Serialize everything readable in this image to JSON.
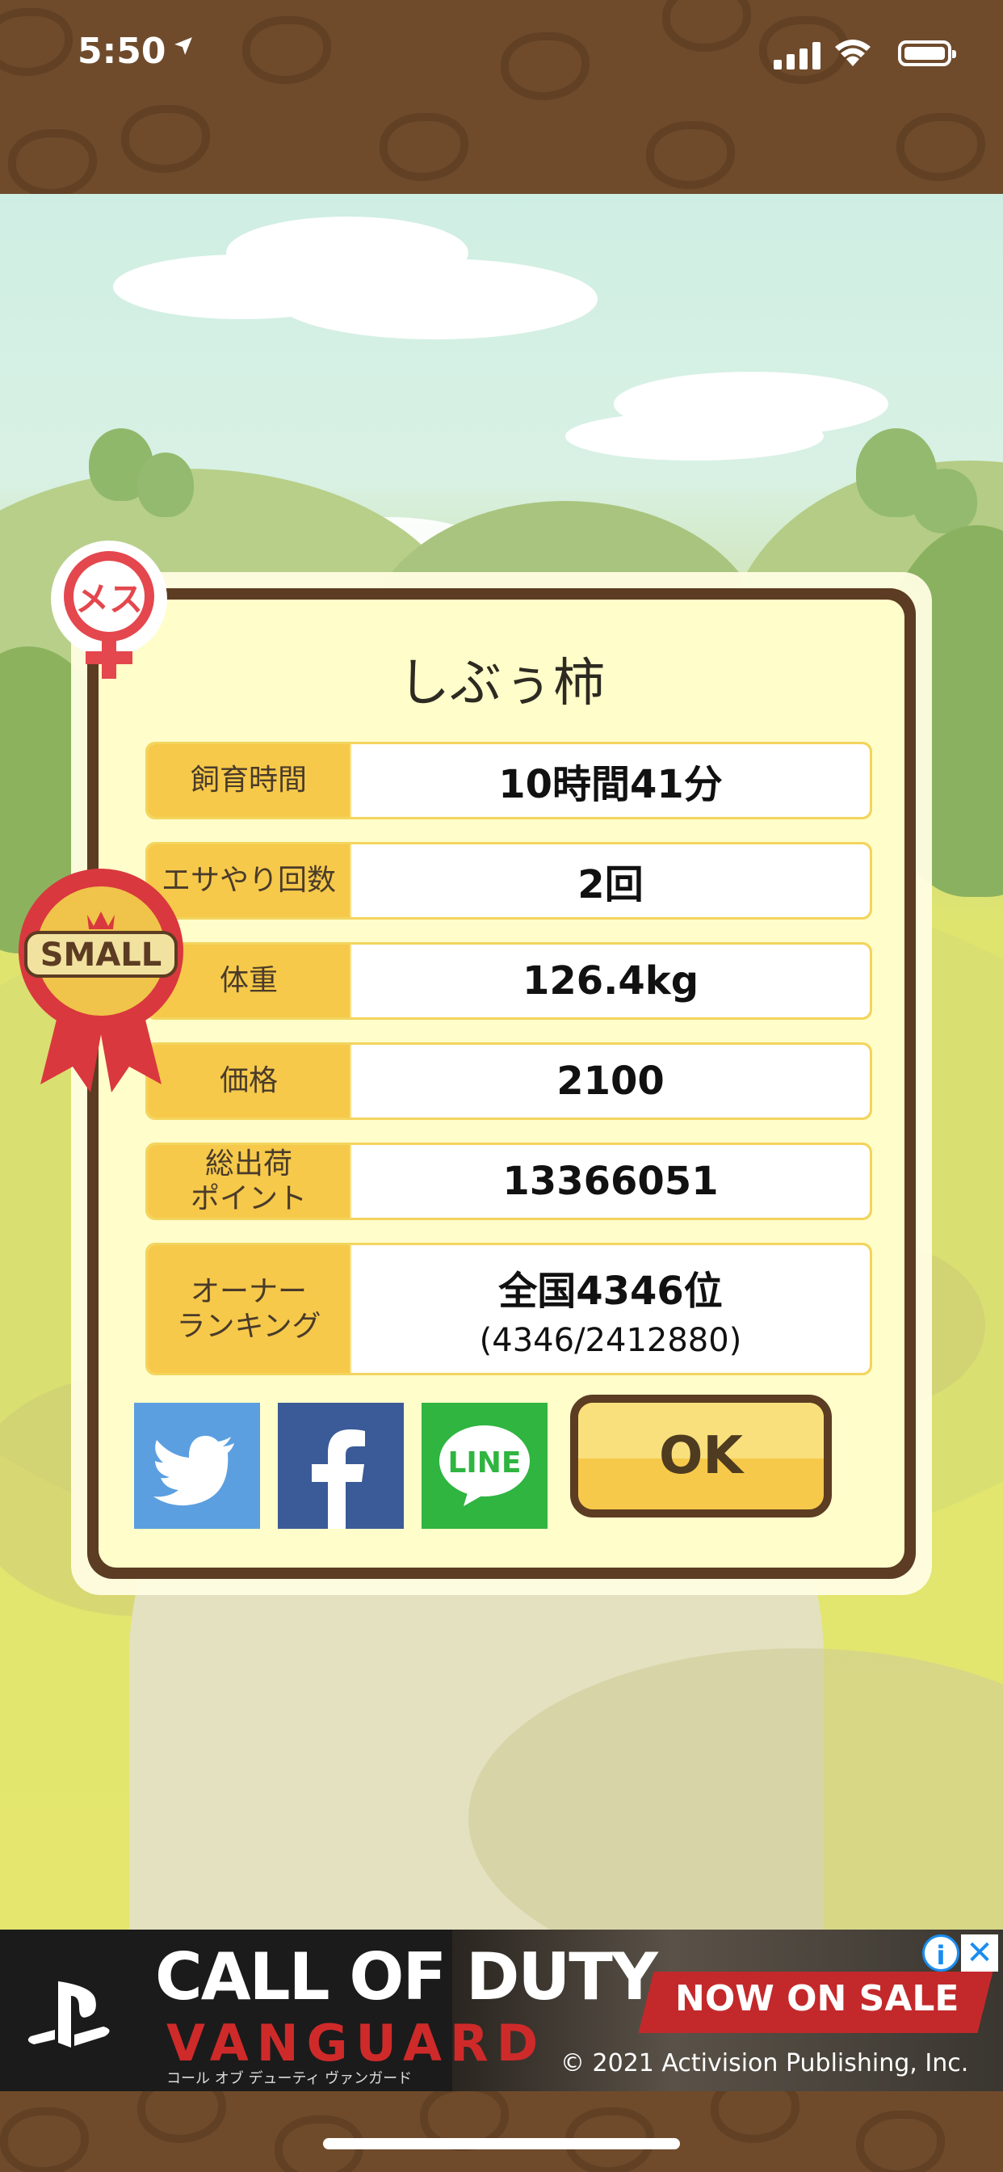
{
  "status_bar": {
    "time": "5:50"
  },
  "dialog": {
    "title": "しぶぅ柿",
    "rows": [
      {
        "label": "飼育時間",
        "value": "10時間41分"
      },
      {
        "label": "エサやり回数",
        "value": "2回"
      },
      {
        "label": "体重",
        "value": "126.4kg"
      },
      {
        "label": "価格",
        "value": "2100"
      },
      {
        "label": "総出荷\nポイント",
        "value": "13366051"
      },
      {
        "label": "オーナー\nランキング",
        "value": "全国4346位",
        "sub": "(4346/2412880)"
      }
    ],
    "share": {
      "twitter_icon": "twitter-icon",
      "facebook_label": "f",
      "line_label": "LINE"
    },
    "ok_label": "OK"
  },
  "badges": {
    "gender": "メス",
    "size": "SMALL"
  },
  "ad": {
    "line1": "CALL OF DUTY",
    "line2": "VANGUARD",
    "line3": "コール オブ デューティ ヴァンガード",
    "sale": "NOW ON SALE",
    "copyright": "© 2021 Activision Publishing, Inc.",
    "info": "i",
    "close": "✕"
  },
  "colors": {
    "brown": "#5c3c22",
    "panel": "#fffdc9",
    "label": "#f6c94a",
    "twitter": "#5b9fe0",
    "facebook": "#3b5a98",
    "line": "#2fb540"
  }
}
